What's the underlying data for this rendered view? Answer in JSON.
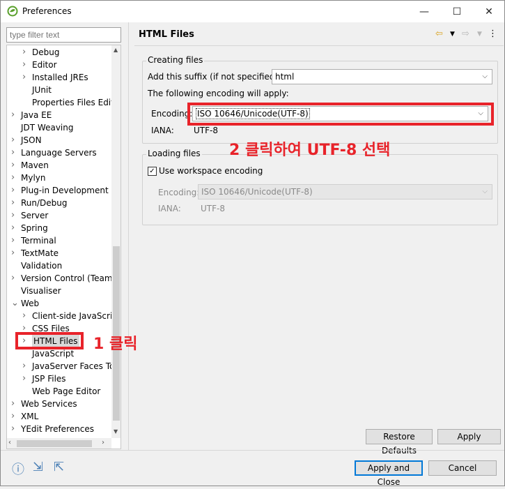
{
  "window": {
    "title": "Preferences",
    "min_glyph": "—",
    "max_glyph": "☐",
    "close_glyph": "✕"
  },
  "filter": {
    "placeholder": "type filter text"
  },
  "tree": [
    {
      "label": "Debug",
      "level": 2,
      "arrow": true
    },
    {
      "label": "Editor",
      "level": 2,
      "arrow": true
    },
    {
      "label": "Installed JREs",
      "level": 2,
      "arrow": true
    },
    {
      "label": "JUnit",
      "level": 2,
      "arrow": false
    },
    {
      "label": "Properties Files Edito",
      "level": 2,
      "arrow": false
    },
    {
      "label": "Java EE",
      "level": 1,
      "arrow": true
    },
    {
      "label": "JDT Weaving",
      "level": 1,
      "arrow": false
    },
    {
      "label": "JSON",
      "level": 1,
      "arrow": true
    },
    {
      "label": "Language Servers",
      "level": 1,
      "arrow": true
    },
    {
      "label": "Maven",
      "level": 1,
      "arrow": true
    },
    {
      "label": "Mylyn",
      "level": 1,
      "arrow": true
    },
    {
      "label": "Plug-in Development",
      "level": 1,
      "arrow": true
    },
    {
      "label": "Run/Debug",
      "level": 1,
      "arrow": true
    },
    {
      "label": "Server",
      "level": 1,
      "arrow": true
    },
    {
      "label": "Spring",
      "level": 1,
      "arrow": true
    },
    {
      "label": "Terminal",
      "level": 1,
      "arrow": true
    },
    {
      "label": "TextMate",
      "level": 1,
      "arrow": true
    },
    {
      "label": "Validation",
      "level": 1,
      "arrow": false
    },
    {
      "label": "Version Control (Team)",
      "level": 1,
      "arrow": true
    },
    {
      "label": "Visualiser",
      "level": 1,
      "arrow": false
    },
    {
      "label": "Web",
      "level": 1,
      "arrow": "open"
    },
    {
      "label": "Client-side JavaScript",
      "level": 2,
      "arrow": true
    },
    {
      "label": "CSS Files",
      "level": 2,
      "arrow": true
    },
    {
      "label": "HTML Files",
      "level": 2,
      "arrow": true,
      "selected": true
    },
    {
      "label": "JavaScript",
      "level": 2,
      "arrow": false
    },
    {
      "label": "JavaServer Faces Too",
      "level": 2,
      "arrow": true
    },
    {
      "label": "JSP Files",
      "level": 2,
      "arrow": true
    },
    {
      "label": "Web Page Editor",
      "level": 2,
      "arrow": false
    },
    {
      "label": "Web Services",
      "level": 1,
      "arrow": true
    },
    {
      "label": "XML",
      "level": 1,
      "arrow": true
    },
    {
      "label": "YEdit Preferences",
      "level": 1,
      "arrow": true
    }
  ],
  "page": {
    "title": "HTML Files",
    "creating": {
      "legend": "Creating files",
      "suffix_label": "Add this suffix (if not specified):",
      "suffix_value": "html",
      "encoding_note": "The following encoding will apply:",
      "encoding_label": "Encoding:",
      "encoding_value": "ISO 10646/Unicode(UTF-8)",
      "iana_label": "IANA:",
      "iana_value": "UTF-8"
    },
    "loading": {
      "legend": "Loading files",
      "checkbox_label": "Use workspace encoding",
      "checkbox_checked": true,
      "encoding_label": "Encoding:",
      "encoding_value": "ISO 10646/Unicode(UTF-8)",
      "iana_label": "IANA:",
      "iana_value": "UTF-8"
    },
    "restore_defaults": "Restore Defaults",
    "apply": "Apply"
  },
  "footer": {
    "apply_close": "Apply and Close",
    "cancel": "Cancel"
  },
  "annotations": {
    "step1": "1 클릭",
    "step2": "2 클릭하여 UTF-8 선택",
    "color": "#e8232a"
  },
  "icons": {
    "app": "eclipse-leaf-icon",
    "back": "back-arrow-icon",
    "forward": "forward-arrow-icon",
    "menu": "view-menu-icon",
    "help": "help-icon",
    "import": "import-icon",
    "export": "export-icon"
  }
}
